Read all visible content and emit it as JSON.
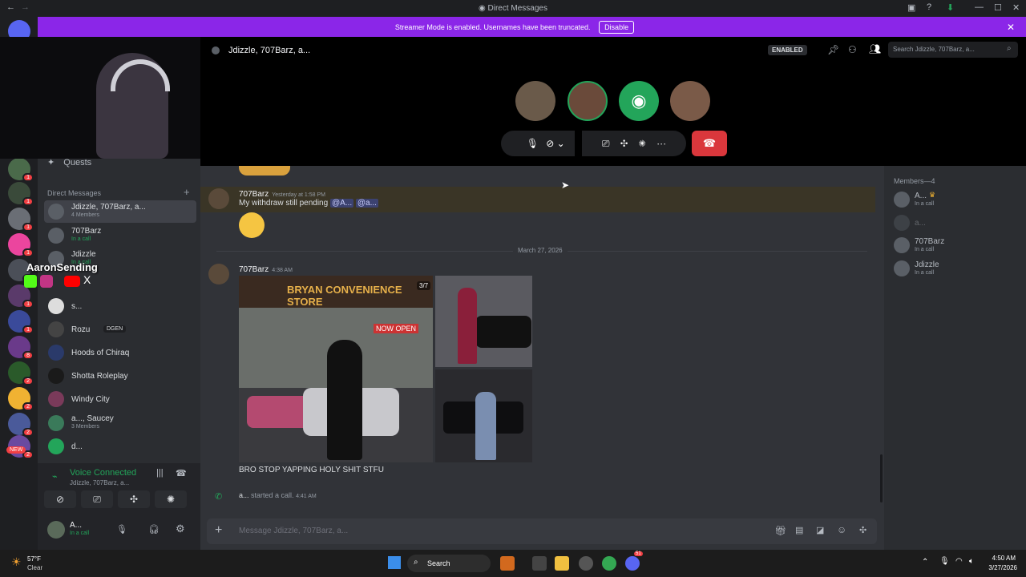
{
  "window": {
    "title": "Direct Messages"
  },
  "banner": {
    "text": "Streamer Mode is enabled. Usernames have been truncated.",
    "disable_label": "Disable"
  },
  "webcam": {
    "overlay_name": "AaronSending"
  },
  "server_badges": [
    "1",
    "1",
    "1",
    "1",
    "1",
    "1",
    "1",
    "8",
    "2",
    "2",
    "2",
    "2"
  ],
  "new_badge": "NEW",
  "sidebar": {
    "quests_label": "Quests",
    "dm_header": "Direct Messages",
    "dms": [
      {
        "name": "Jdizzle, 707Barz, a...",
        "sub": "4 Members"
      },
      {
        "name": "707Barz",
        "sub": "In a call"
      },
      {
        "name": "Jdizzle",
        "sub": "In a call"
      },
      {
        "name": "s...",
        "sub": ""
      },
      {
        "name": "Rozu",
        "tag": "DGEN",
        "sub": ""
      },
      {
        "name": "Hoods of Chiraq",
        "sub": ""
      },
      {
        "name": "Shotta Roleplay",
        "sub": ""
      },
      {
        "name": "Windy City",
        "sub": ""
      },
      {
        "name": "a..., Saucey",
        "sub": "3 Members"
      },
      {
        "name": "d...",
        "sub": ""
      }
    ],
    "voice": {
      "status": "Voice Connected",
      "channel": "Jdizzle, 707Barz, a..."
    },
    "user": {
      "name": "A...",
      "status": "In a call"
    }
  },
  "header": {
    "title": "Jdizzle, 707Barz, a...",
    "enabled_badge": "ENABLED",
    "search_placeholder": "Search Jdizzle, 707Barz, a..."
  },
  "chat": {
    "messages": [
      {
        "author": "707Barz",
        "time": "Yesterday at 1:58 PM",
        "text": "My withdraw still pending",
        "mentions": [
          "@A...",
          "@a..."
        ]
      },
      {
        "author": "707Barz",
        "time": "4:38 AM",
        "image_counter": "3/7",
        "store_sign": "BRYAN CONVENIENCE STORE",
        "now_open": "NOW OPEN",
        "text": "BRO STOP YAPPING HOLY SHIT STFU"
      }
    ],
    "date_divider": "March 27, 2026",
    "call_event": {
      "user": "a...",
      "text": "started a call.",
      "time": "4:41 AM"
    },
    "input_placeholder": "Message Jdizzle, 707Barz, a..."
  },
  "members": {
    "header": "Members—4",
    "list": [
      {
        "name": "A...",
        "status": "In a call"
      },
      {
        "name": "a...",
        "status": ""
      },
      {
        "name": "707Barz",
        "status": "In a call"
      },
      {
        "name": "Jdizzle",
        "status": "In a call"
      }
    ]
  },
  "taskbar": {
    "temp": "57°F",
    "weather": "Clear",
    "search_label": "Search",
    "time": "4:50 AM",
    "date": "3/27/2026",
    "discord_badge": "51"
  },
  "colors": {
    "brand": "#5865f2",
    "banner": "#8b26e8",
    "hangup": "#da373c",
    "online": "#23a55a"
  }
}
